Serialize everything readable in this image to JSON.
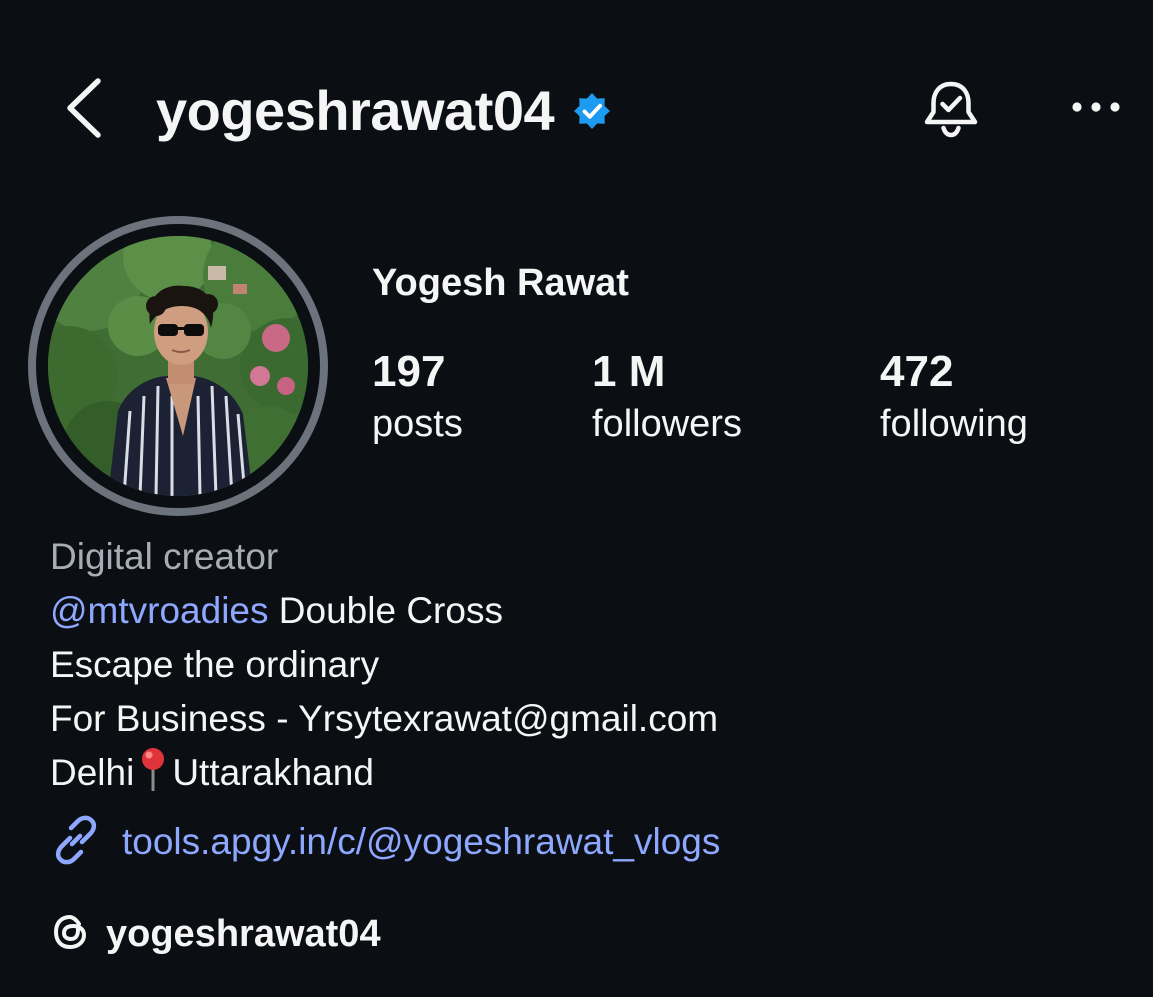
{
  "header": {
    "username": "yogeshrawat04",
    "verified": true,
    "icons": {
      "back": "chevron-left-icon",
      "verified": "verified-badge-icon",
      "notifications": "bell-check-icon",
      "more": "more-horizontal-icon"
    }
  },
  "profile": {
    "display_name": "Yogesh Rawat",
    "stats": {
      "posts": {
        "value": "197",
        "label": "posts"
      },
      "followers": {
        "value": "1 M",
        "label": "followers"
      },
      "following": {
        "value": "472",
        "label": "following"
      }
    }
  },
  "bio": {
    "category": "Digital creator",
    "mention": "@mtvroadies",
    "mention_suffix": " Double Cross",
    "line2": "Escape the ordinary",
    "line3": "For Business - Yrsytexrawat@gmail.com",
    "line4_before": "Delhi",
    "line4_after": "Uttarakhand",
    "location_icon": "round-pushpin-icon"
  },
  "link": {
    "text": "tools.apgy.in/c/@yogeshrawat_vlogs",
    "icon": "link-icon"
  },
  "threads": {
    "handle": "yogeshrawat04",
    "icon": "threads-icon"
  },
  "colors": {
    "background": "#0b0f14",
    "text": "#f5f5f5",
    "muted": "#a8adb5",
    "link": "#8ea8ff",
    "verified": "#1d9bf0",
    "avatar_ring": "#6d737c"
  }
}
